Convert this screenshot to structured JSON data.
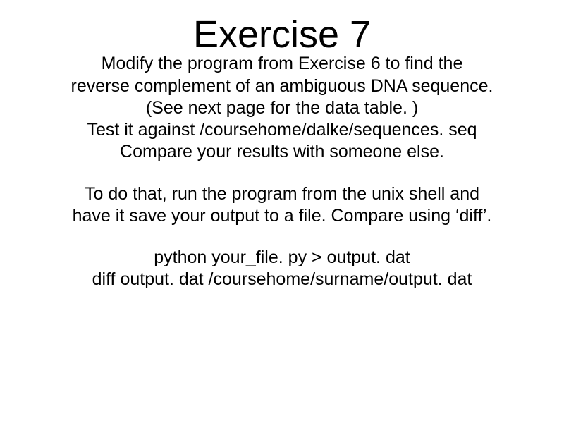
{
  "title": "Exercise 7",
  "block1": {
    "line1": "Modify the program from Exercise 6 to find the",
    "line2": "reverse complement of an ambiguous DNA sequence.",
    "line3": "(See next page for the data table. )",
    "line4": "Test it against /coursehome/dalke/sequences. seq",
    "line5": "Compare your results with someone else."
  },
  "block2": {
    "line1": "To do that, run the program from the unix shell and",
    "line2": "have it save your output to a file.  Compare using ‘diff’."
  },
  "block3": {
    "line1": "python your_file. py > output. dat",
    "line2": "diff output. dat /coursehome/surname/output. dat"
  }
}
